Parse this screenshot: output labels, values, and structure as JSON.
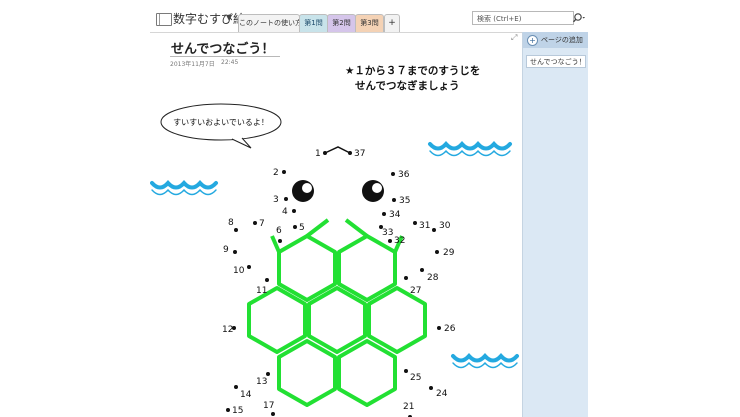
{
  "notebook": {
    "title": "数字むすび絵"
  },
  "tabs": [
    {
      "label": "このノートの使い方"
    },
    {
      "label": "第1問"
    },
    {
      "label": "第2問"
    },
    {
      "label": "第3問"
    },
    {
      "label": "+"
    }
  ],
  "search": {
    "placeholder": "検索 (Ctrl+E)"
  },
  "pane": {
    "add_page": "ページの追加",
    "pages": [
      {
        "label": "せんでつなごう！"
      }
    ]
  },
  "page": {
    "title": "せんでつなごう！",
    "date": "2013年11月7日",
    "time": "22:45",
    "instruction_line1": "★１から３７までのすうじを",
    "instruction_line2": "せんでつなぎましょう",
    "speech": "すいすいおよいでいるよ！"
  },
  "colors": {
    "shell": "#22e033",
    "wave": "#24a9e0",
    "accent": "#c8e3ea"
  },
  "dots": [
    "1",
    "2",
    "3",
    "4",
    "5",
    "6",
    "7",
    "8",
    "9",
    "10",
    "11",
    "12",
    "13",
    "14",
    "15",
    "17",
    "21",
    "24",
    "25",
    "26",
    "27",
    "28",
    "29",
    "30",
    "31",
    "32",
    "33",
    "34",
    "35",
    "36",
    "37"
  ]
}
